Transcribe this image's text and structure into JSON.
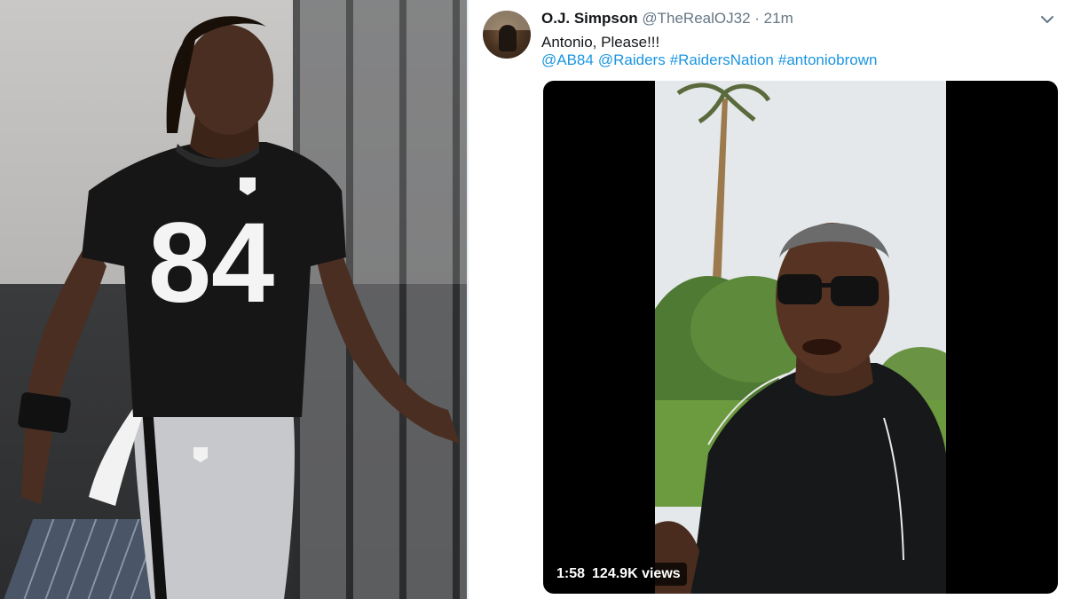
{
  "tweet": {
    "display_name": "O.J. Simpson",
    "handle": "@TheRealOJ32",
    "separator": "·",
    "time": "21m",
    "text": "Antonio, Please!!!",
    "tags": [
      "@AB84",
      "@Raiders",
      "#RaidersNation",
      "#antoniobrown"
    ],
    "video": {
      "duration": "1:58",
      "views": "124.9K views"
    }
  },
  "photo_left": {
    "jersey_number": "84"
  },
  "colors": {
    "link": "#1b95e0",
    "name": "#14171a",
    "secondary": "#657786"
  },
  "icons": [
    "chevron-down-icon"
  ]
}
